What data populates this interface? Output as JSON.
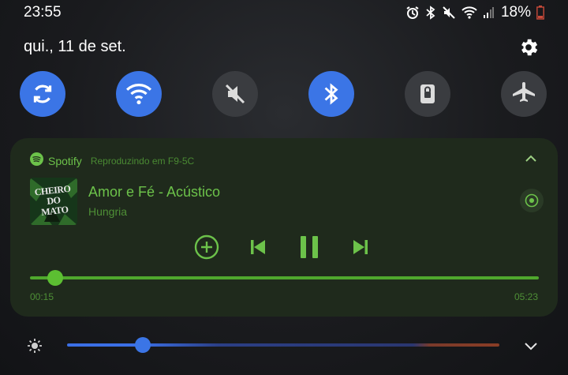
{
  "status_bar": {
    "time": "23:55",
    "battery": "18%",
    "icons": [
      "alarm-icon",
      "bluetooth-icon",
      "mute-icon",
      "wifi-icon",
      "signal-icon",
      "battery-icon"
    ]
  },
  "panel": {
    "date": "qui., 11 de set.",
    "quick_settings": [
      {
        "name": "auto-rotate",
        "icon": "sync-icon",
        "on": true
      },
      {
        "name": "wifi",
        "icon": "wifi-icon",
        "on": true
      },
      {
        "name": "sound",
        "icon": "mute-icon",
        "on": false
      },
      {
        "name": "bluetooth",
        "icon": "bluetooth-icon",
        "on": true
      },
      {
        "name": "secure-folder",
        "icon": "lock-icon",
        "on": false
      },
      {
        "name": "airplane-mode",
        "icon": "airplane-icon",
        "on": false
      }
    ]
  },
  "player": {
    "app": "Spotify",
    "device": "Reproduzindo em F9-5C",
    "album_art_text": "CHEIRO DO MATO",
    "title": "Amor e Fé - Acústico",
    "artist": "Hungria",
    "elapsed": "00:15",
    "duration": "05:23",
    "progress": 0.05,
    "colors": {
      "accent": "#6cc24a",
      "background": "#1f2a1c"
    }
  },
  "brightness": {
    "level": 0.17,
    "colors": {
      "fill": "#3b75e6"
    }
  }
}
